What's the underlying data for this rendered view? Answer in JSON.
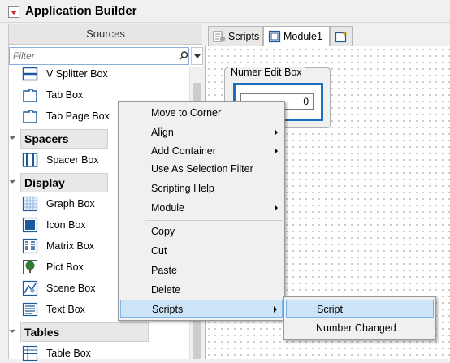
{
  "window": {
    "title": "Application Builder",
    "title_toggle_icon": "red-disclosure-triangle"
  },
  "sources": {
    "header": "Sources",
    "filter_placeholder": "Filter",
    "items_top": [
      {
        "label": "V Splitter Box",
        "icon": "v-splitter-icon"
      },
      {
        "label": "Tab Box",
        "icon": "tab-box-icon"
      },
      {
        "label": "Tab Page Box",
        "icon": "tab-page-icon"
      }
    ],
    "groups": [
      {
        "label": "Spacers",
        "items": [
          {
            "label": "Spacer Box",
            "icon": "spacer-icon"
          }
        ]
      },
      {
        "label": "Display",
        "items": [
          {
            "label": "Graph Box",
            "icon": "graph-icon"
          },
          {
            "label": "Icon Box",
            "icon": "icon-box-icon"
          },
          {
            "label": "Matrix Box",
            "icon": "matrix-icon"
          },
          {
            "label": "Pict Box",
            "icon": "tree-picture-icon"
          },
          {
            "label": "Scene Box",
            "icon": "scene-icon"
          },
          {
            "label": "Text Box",
            "icon": "text-box-icon"
          }
        ]
      },
      {
        "label": "Tables",
        "items": [
          {
            "label": "Table Box",
            "icon": "table-icon"
          }
        ]
      }
    ]
  },
  "tabs": [
    {
      "label": "Scripts",
      "icon": "scripts-icon",
      "active": false
    },
    {
      "label": "Module1",
      "icon": "module-icon",
      "active": true
    },
    {
      "label": "",
      "icon": "new-module-icon",
      "active": false
    }
  ],
  "canvas": {
    "numeric_box": {
      "label": "Numer Edit Box",
      "value": "0"
    }
  },
  "context_menu": {
    "items": [
      {
        "label": "Move to Corner",
        "submenu": false
      },
      {
        "label": "Align",
        "submenu": true
      },
      {
        "label": "Add Container",
        "submenu": true
      },
      {
        "label": "Use As Selection Filter",
        "submenu": false
      },
      {
        "label": "Scripting Help",
        "submenu": false
      },
      {
        "label": "Module",
        "submenu": true
      },
      {
        "label": "Copy",
        "submenu": false
      },
      {
        "label": "Cut",
        "submenu": false
      },
      {
        "label": "Paste",
        "submenu": false
      },
      {
        "label": "Delete",
        "submenu": false
      },
      {
        "label": "Scripts",
        "submenu": true,
        "highlighted": true
      }
    ],
    "scripts_submenu": [
      {
        "label": "Script",
        "highlighted": true
      },
      {
        "label": "Number Changed",
        "highlighted": false
      }
    ]
  },
  "colors": {
    "accent_blue": "#1a6fc0",
    "highlight": "#cce4f7",
    "toggle_red": "#d21f1f"
  }
}
